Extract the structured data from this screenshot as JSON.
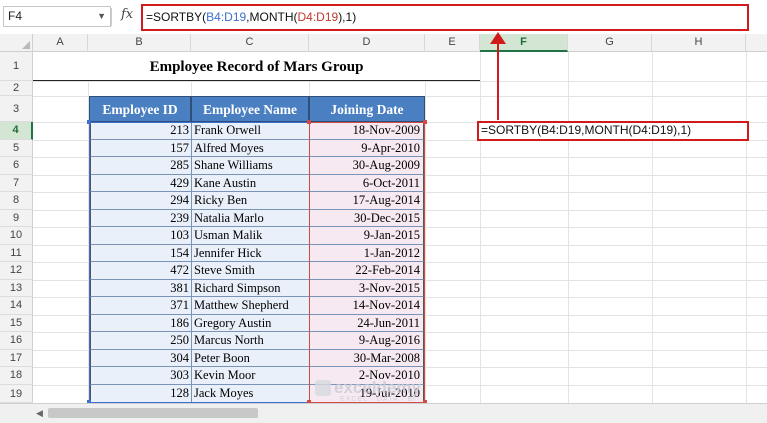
{
  "formula_bar": {
    "name_box": "F4",
    "fx_label": "fx",
    "formula_parts": [
      "=SORTBY(",
      "B4:D19",
      ",MONTH(",
      "D4:D19",
      "),1)"
    ]
  },
  "columns": [
    "A",
    "B",
    "C",
    "D",
    "E",
    "F",
    "G",
    "H"
  ],
  "selected_column": "F",
  "rows": [
    "1",
    "2",
    "3",
    "4",
    "5",
    "6",
    "7",
    "8",
    "9",
    "10",
    "11",
    "12",
    "13",
    "14",
    "15",
    "16",
    "17",
    "18",
    "19"
  ],
  "selected_row": "4",
  "sheet": {
    "title": "Employee Record of Mars Group",
    "headers": [
      "Employee ID",
      "Employee Name",
      "Joining Date"
    ],
    "records": [
      [
        "213",
        "Frank Orwell",
        "18-Nov-2009"
      ],
      [
        "157",
        "Alfred Moyes",
        "9-Apr-2010"
      ],
      [
        "285",
        "Shane Williams",
        "30-Aug-2009"
      ],
      [
        "429",
        "Kane Austin",
        "6-Oct-2011"
      ],
      [
        "294",
        "Ricky Ben",
        "17-Aug-2014"
      ],
      [
        "239",
        "Natalia Marlo",
        "30-Dec-2015"
      ],
      [
        "103",
        "Usman Malik",
        "9-Jan-2015"
      ],
      [
        "154",
        "Jennifer Hick",
        "1-Jan-2012"
      ],
      [
        "472",
        "Steve Smith",
        "22-Feb-2014"
      ],
      [
        "381",
        "Richard Simpson",
        "3-Nov-2015"
      ],
      [
        "371",
        "Matthew Shepherd",
        "14-Nov-2014"
      ],
      [
        "186",
        "Gregory Austin",
        "24-Jun-2011"
      ],
      [
        "250",
        "Marcus North",
        "9-Aug-2016"
      ],
      [
        "304",
        "Peter Boon",
        "30-Mar-2008"
      ],
      [
        "303",
        "Kevin Moor",
        "2-Nov-2010"
      ],
      [
        "128",
        "Jack Moyes",
        "19-Jul-2010"
      ]
    ],
    "active_cell_formula": "=SORTBY(B4:D19,MONTH(D4:D19),1)"
  },
  "watermark": {
    "brand": "exceldemy",
    "tagline": "EXCEL · DATA · BI"
  },
  "colors": {
    "header_fill": "#4a7fc1",
    "highlight": "#d11a1a",
    "ref_blue": "#3c6fcf",
    "ref_red": "#c0392b",
    "excel_green": "#217346"
  }
}
